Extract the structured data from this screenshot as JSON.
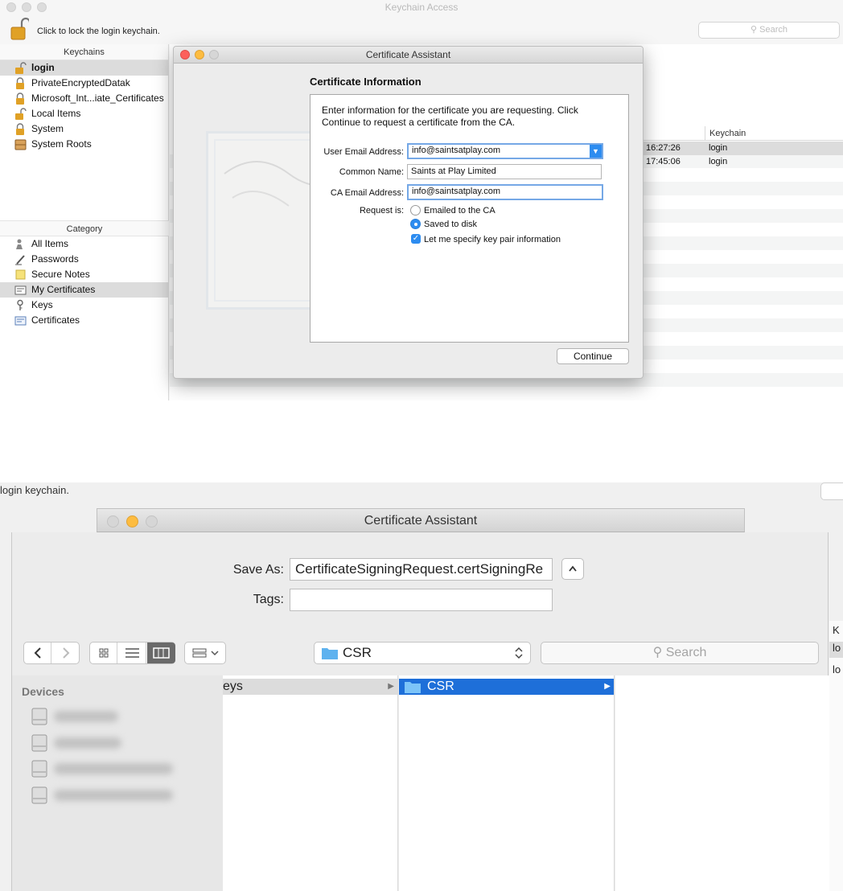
{
  "top": {
    "window_title": "Keychain Access",
    "lock_text": "Click to lock the login keychain.",
    "search_placeholder": "Search",
    "keychains_header": "Keychains",
    "keychains": [
      {
        "label": "login",
        "icon": "lock-open-icon",
        "selected": true
      },
      {
        "label": "PrivateEncryptedDatak",
        "icon": "lock-icon"
      },
      {
        "label": "Microsoft_Int...iate_Certificates",
        "icon": "lock-icon"
      },
      {
        "label": "Local Items",
        "icon": "lock-open-icon"
      },
      {
        "label": "System",
        "icon": "lock-icon"
      },
      {
        "label": "System Roots",
        "icon": "cabinet-icon"
      }
    ],
    "category_header": "Category",
    "categories": [
      {
        "label": "All Items",
        "icon": "people-icon"
      },
      {
        "label": "Passwords",
        "icon": "pen-icon"
      },
      {
        "label": "Secure Notes",
        "icon": "note-icon"
      },
      {
        "label": "My Certificates",
        "icon": "certificate-icon",
        "selected": true
      },
      {
        "label": "Keys",
        "icon": "key-icon"
      },
      {
        "label": "Certificates",
        "icon": "certificate-icon"
      }
    ],
    "list": {
      "keychain_column": "Keychain",
      "rows": [
        {
          "time": "16:27:26",
          "keychain": "login"
        },
        {
          "time": "17:45:06",
          "keychain": "login"
        }
      ]
    },
    "dialog": {
      "title": "Certificate Assistant",
      "heading": "Certificate Information",
      "intro": "Enter information for the certificate you are requesting. Click Continue to request a certificate from the CA.",
      "user_email_label": "User Email Address:",
      "user_email_value": "info@saintsatplay.com",
      "common_name_label": "Common Name:",
      "common_name_value": "Saints at Play Limited",
      "ca_email_label": "CA Email Address:",
      "ca_email_value": "info@saintsatplay.com",
      "request_label": "Request is:",
      "option_emailed": "Emailed to the CA",
      "option_saved": "Saved to disk",
      "selected_option": "Saved to disk",
      "specify_keypair_label": "Let me specify key pair information",
      "specify_keypair_checked": true,
      "continue_label": "Continue"
    }
  },
  "bottom": {
    "behind_text": "login keychain.",
    "title": "Certificate Assistant",
    "save_as_label": "Save As:",
    "save_as_value": "CertificateSigningRequest.certSigningRe",
    "tags_label": "Tags:",
    "tags_value": "",
    "location": "CSR",
    "search_placeholder": "Search",
    "sidebar_header": "Devices",
    "devices_count_visible": 4,
    "column1_item": "eys",
    "column2_item": "CSR",
    "right_strip": [
      "K",
      "lo",
      "lo"
    ]
  },
  "colors": {
    "selection_blue": "#1e6fd9",
    "accent_blue": "#2d8cf0",
    "traffic_red": "#fc605c",
    "traffic_yellow": "#fdbc40"
  }
}
